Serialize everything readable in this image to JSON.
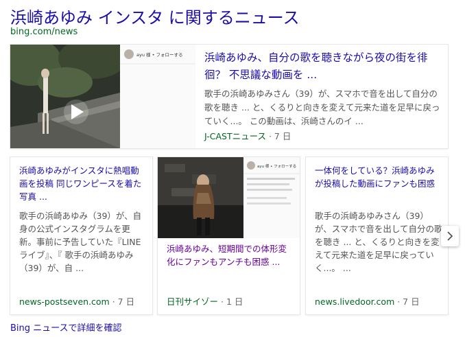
{
  "header": {
    "title": "浜崎あゆみ インスタ に関するニュース",
    "source": "bing.com/news"
  },
  "featured": {
    "headline": "浜崎あゆみ、自分の歌を聴きながら夜の街を徘徊？ 不思議な動画を ...",
    "snippet": "歌手の浜崎あゆみさん（39）が、スマホで音を出して自分の歌を聴き ... と、くるりと向きを変えて元来た道を足早に戻っていく...。 この動画は、浜崎さんのイ ...",
    "publisher": "J-CASTニュース",
    "age": "7 日",
    "thumb_caption": "ayu 様 • フォローする",
    "play_icon": "play-icon"
  },
  "cards": [
    {
      "headline": "浜崎あゆみがインスタに熱唱動画を投稿 同じワンピースを着た写真 ...",
      "snippet": "歌手の浜崎あゆみ（39）が、自身の公式インスタグラムを更新。事前に予告していた『LINEライブ』、『 歌手の浜崎あゆみ（39）が、自 ...",
      "publisher": "news-postseven.com",
      "age": "7 日"
    },
    {
      "headline": "浜崎あゆみ、短期間での体形変化にファンもアンチも困惑 ...",
      "publisher": "日刊サイゾー",
      "age": "1 日",
      "thumb_caption": "ayu 様 • フォローする"
    },
    {
      "headline": "一体何をしている？浜崎あゆみが投稿した動画にファンも困惑",
      "snippet": "歌手の浜崎あゆみさん（39）が、スマホで音を出して自分の歌を聴き ... と、くるりと向きを変えて元来た道を足早に戻っていく...。 ...",
      "publisher": "news.livedoor.com",
      "age": "7 日"
    }
  ],
  "more_link": "Bing ニュースで詳細を確認",
  "next_icon": "chevron-right-icon",
  "separator": " · "
}
